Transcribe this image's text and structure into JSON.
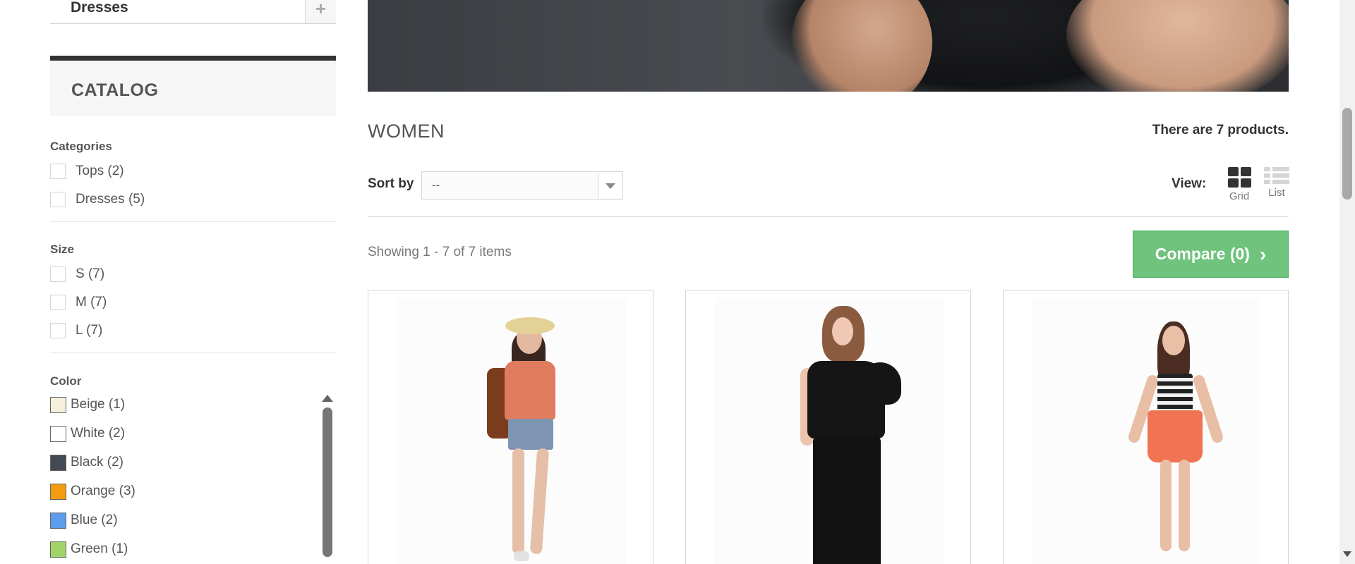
{
  "sidebar": {
    "top_item": {
      "label": "Dresses",
      "expand_symbol": "+"
    },
    "block_title": "Catalog",
    "categories": {
      "heading": "Categories",
      "items": [
        {
          "label": "Tops (2)"
        },
        {
          "label": "Dresses (5)"
        }
      ]
    },
    "size": {
      "heading": "Size",
      "items": [
        {
          "label": "S (7)"
        },
        {
          "label": "M (7)"
        },
        {
          "label": "L (7)"
        }
      ]
    },
    "color": {
      "heading": "Color",
      "items": [
        {
          "label": "Beige (1)",
          "swatch": "#f5f1dc"
        },
        {
          "label": "White (2)",
          "swatch": "#ffffff"
        },
        {
          "label": "Black (2)",
          "swatch": "#434a54"
        },
        {
          "label": "Orange (3)",
          "swatch": "#f39c11"
        },
        {
          "label": "Blue (2)",
          "swatch": "#5d9cec"
        },
        {
          "label": "Green (1)",
          "swatch": "#a0d468"
        }
      ]
    }
  },
  "category": {
    "title": "Women",
    "product_count": "There are 7 products."
  },
  "toolbar": {
    "sort_label": "Sort by",
    "sort_value": "--",
    "view_label": "View:",
    "view_grid_label": "Grid",
    "view_list_label": "List",
    "showing_text": "Showing 1 - 7 of 7 items",
    "compare_label": "Compare (0)"
  },
  "products": [
    {
      "image": "model-orange-top-denim-shorts"
    },
    {
      "image": "model-black-ruffle-top-black-pants"
    },
    {
      "image": "model-striped-top-orange-skirt"
    }
  ],
  "colors": {
    "compare_button": "#6fc37d",
    "border": "#d6d4d4",
    "catalog_bar": "#333333"
  },
  "icons": {
    "expand": "plus-icon",
    "sort_dropdown": "chevron-down-icon",
    "grid_view": "grid-icon",
    "list_view": "list-icon",
    "compare_chevron": "chevron-right-icon"
  }
}
